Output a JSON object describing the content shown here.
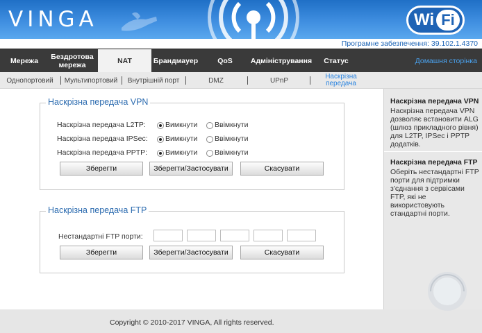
{
  "header": {
    "logo": "VINGA",
    "wifi_wi": "Wi",
    "wifi_fi": "Fi",
    "firmware": "Програмне забезпечення: 39.102.1.4370",
    "colors": {
      "header_blue": "#3f8ee0",
      "nav_dark": "#3a3a3a",
      "accent": "#2d6cb0"
    }
  },
  "mainnav": {
    "items": [
      {
        "label": "Мережа"
      },
      {
        "label": "Бездротова мережа"
      },
      {
        "label": "NAT"
      },
      {
        "label": "Брандмауер"
      },
      {
        "label": "QoS"
      },
      {
        "label": "Адміністрування"
      },
      {
        "label": "Статус"
      }
    ],
    "active": "NAT",
    "home": "Домашня сторінка"
  },
  "subnav": {
    "items": [
      {
        "label": "Однопортовий"
      },
      {
        "label": "Мультипортовий"
      },
      {
        "label": "Внутрішній порт"
      },
      {
        "label": "DMZ"
      },
      {
        "label": "UPnP"
      },
      {
        "label": "Наскрізна передача"
      }
    ],
    "active": "Наскрізна передача"
  },
  "vpn": {
    "title": "Наскрізна передача VPN",
    "rows": [
      {
        "label": "Наскрізна передача L2TP:",
        "off": "Вимкнути",
        "on": "Ввімкнути",
        "selected": "off"
      },
      {
        "label": "Наскрізна передача IPSec:",
        "off": "Вимкнути",
        "on": "Ввімкнути",
        "selected": "off"
      },
      {
        "label": "Наскрізна передача PPTP:",
        "off": "Вимкнути",
        "on": "Ввімкнути",
        "selected": "off"
      }
    ],
    "save": "Зберегти",
    "save_apply": "Зберегти/Застосувати",
    "cancel": "Скасувати"
  },
  "ftp": {
    "title": "Наскрізна передача FTP",
    "ports_label": "Нестандартні FTP порти:",
    "ports": [
      "",
      "",
      "",
      "",
      ""
    ],
    "save": "Зберегти",
    "save_apply": "Зберегти/Застосувати",
    "cancel": "Скасувати"
  },
  "help": {
    "vpn_title": "Наскрізна передача VPN",
    "vpn_text": "Наскрізна передача VPN дозволяє встановити ALG (шлюз прикладного рівня) для L2TP, IPSec і PPTP додатків.",
    "ftp_title": "Наскрізна передача FTP",
    "ftp_text": "Оберіть нестандартні FTP порти для підтримки з'єднання з сервісами FTP, які не використовують стандартні порти."
  },
  "footer": {
    "copyright": "Copyright © 2010-2017 VINGA, All rights reserved."
  }
}
